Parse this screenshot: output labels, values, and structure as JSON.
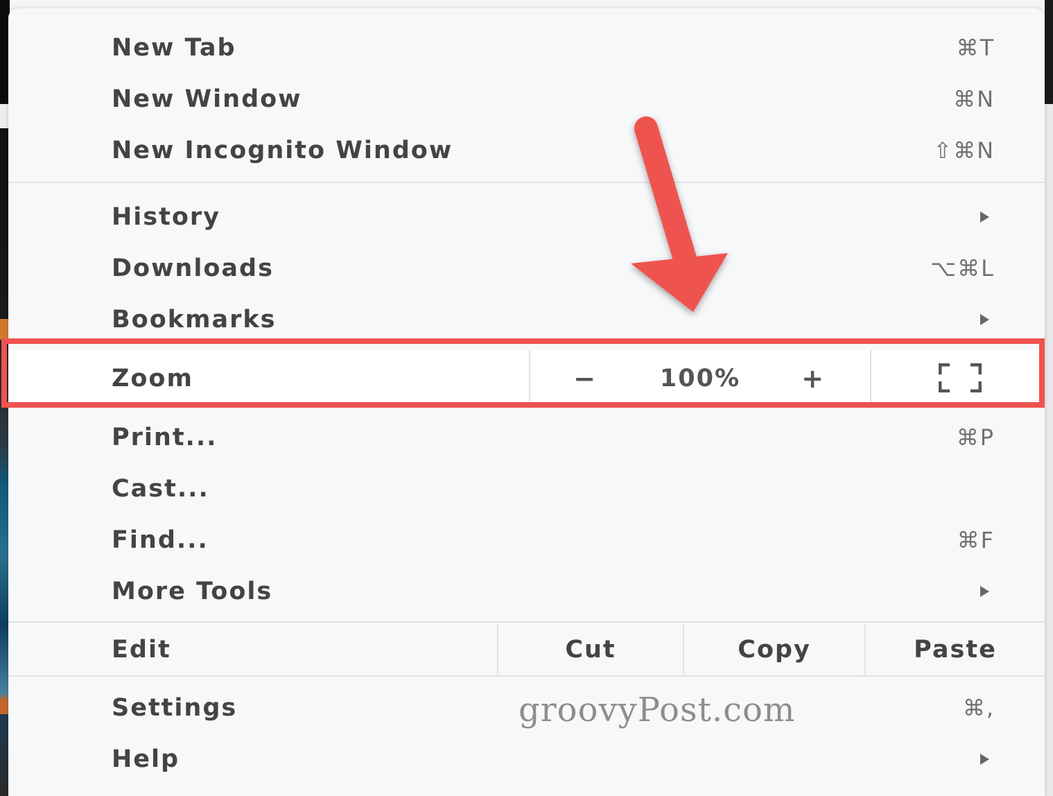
{
  "menu": {
    "items_top": [
      {
        "label": "New Tab",
        "shortcut": "⌘T"
      },
      {
        "label": "New Window",
        "shortcut": "⌘N"
      },
      {
        "label": "New Incognito Window",
        "shortcut": "⇧⌘N"
      }
    ],
    "items_mid": [
      {
        "label": "History",
        "submenu": true
      },
      {
        "label": "Downloads",
        "shortcut": "⌥⌘L"
      },
      {
        "label": "Bookmarks",
        "submenu": true
      }
    ],
    "zoom": {
      "label": "Zoom",
      "minus": "−",
      "value": "100%",
      "plus": "+",
      "fullscreen_icon": "fullscreen-icon"
    },
    "items_tools": [
      {
        "label": "Print...",
        "shortcut": "⌘P"
      },
      {
        "label": "Cast..."
      },
      {
        "label": "Find...",
        "shortcut": "⌘F"
      },
      {
        "label": "More Tools",
        "submenu": true
      }
    ],
    "edit": {
      "label": "Edit",
      "cut": "Cut",
      "copy": "Copy",
      "paste": "Paste"
    },
    "items_bottom": [
      {
        "label": "Settings",
        "shortcut": "⌘,"
      },
      {
        "label": "Help",
        "submenu": true
      }
    ]
  },
  "watermark": "groovyPost.com",
  "annotation": {
    "highlight_color": "#ef5350",
    "arrow_color": "#ef5350"
  }
}
